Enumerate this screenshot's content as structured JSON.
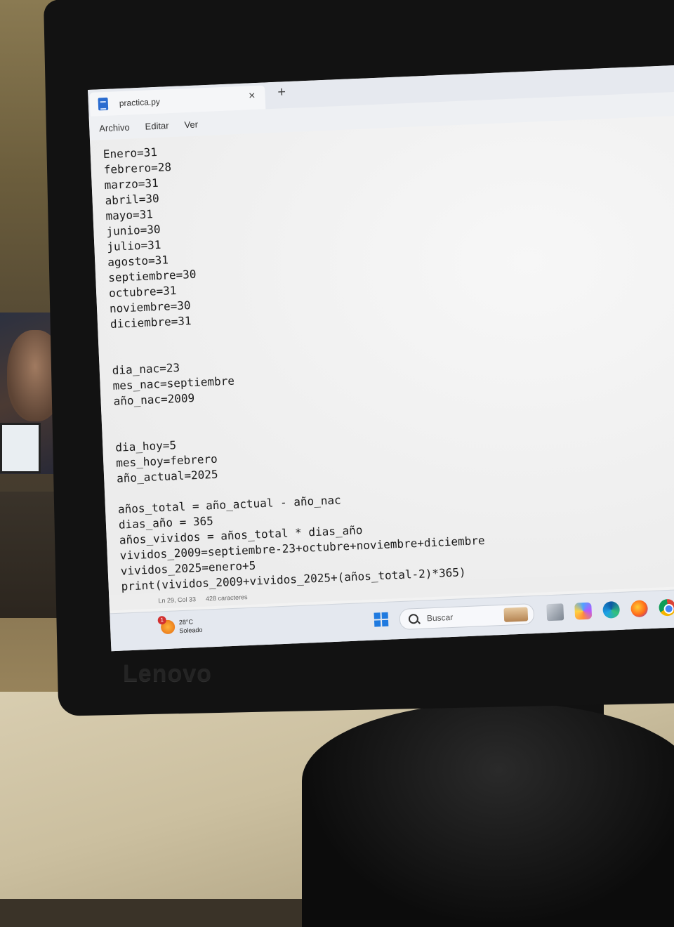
{
  "window": {
    "tab_title": "practica.py",
    "close_glyph": "×",
    "new_tab_glyph": "+"
  },
  "menu": [
    "Archivo",
    "Editar",
    "Ver"
  ],
  "code_lines": [
    "Enero=31",
    "febrero=28",
    "marzo=31",
    "abril=30",
    "mayo=31",
    "junio=30",
    "julio=31",
    "agosto=31",
    "septiembre=30",
    "octubre=31",
    "noviembre=30",
    "diciembre=31",
    "",
    "",
    "dia_nac=23",
    "mes_nac=septiembre",
    "año_nac=2009",
    "",
    "",
    "dia_hoy=5",
    "mes_hoy=febrero",
    "año_actual=2025",
    "",
    "años_total = año_actual - año_nac",
    "dias_año = 365",
    "años_vividos = años_total * dias_año",
    "vividos_2009=septiembre-23+octubre+noviembre+diciembre",
    "vividos_2025=enero+5",
    "print(vividos_2009+vividos_2025+(años_total-2)*365)"
  ],
  "status": {
    "position": "Ln 29, Col 33",
    "chars": "428 caracteres"
  },
  "taskbar": {
    "weather_temp": "28°C",
    "weather_desc": "Soleado",
    "weather_badge": "1",
    "search_placeholder": "Buscar",
    "apps": [
      "task-view",
      "copilot",
      "edge",
      "firefox",
      "chrome",
      "opera"
    ]
  },
  "monitor": {
    "brand": "Lenovo"
  }
}
